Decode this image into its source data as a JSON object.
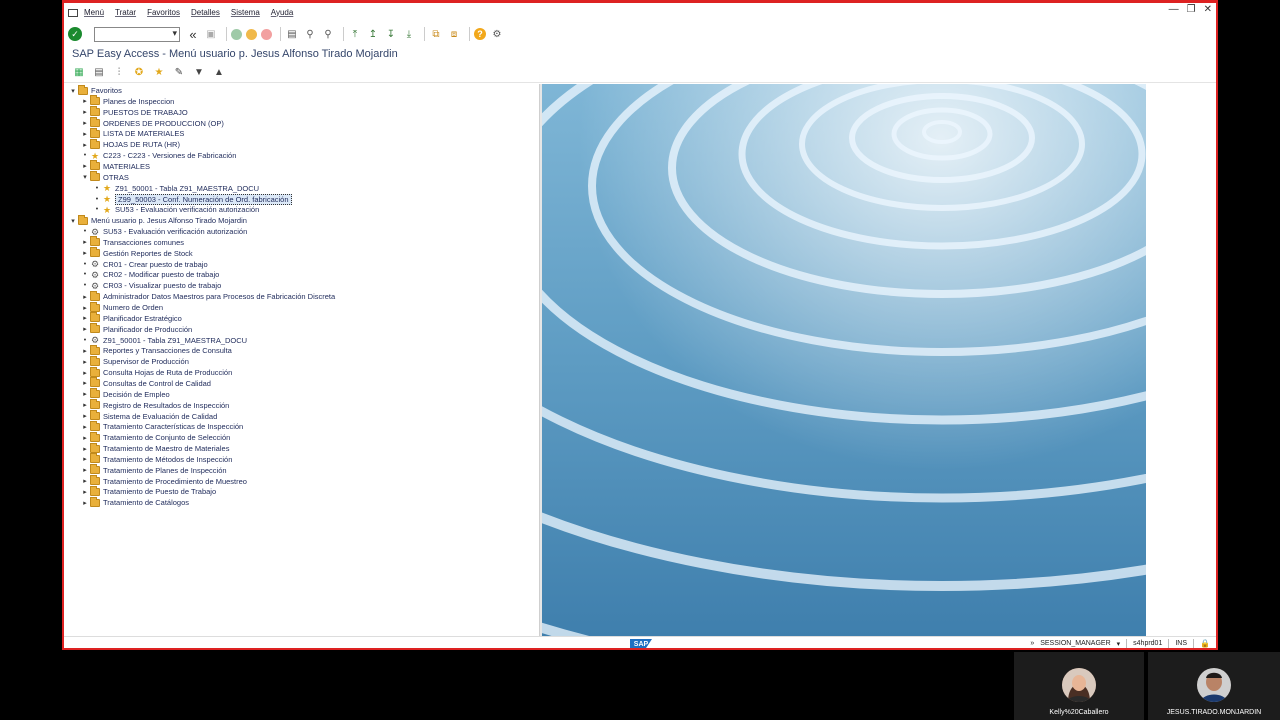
{
  "window": {
    "menu": [
      "Menú",
      "Tratar",
      "Favoritos",
      "Detalles",
      "Sistema",
      "Ayuda"
    ],
    "controls": [
      "—",
      "❐",
      "✕"
    ],
    "title": "SAP Easy Access  -  Menú usuario p. Jesus Alfonso Tirado Mojardin"
  },
  "icons": {
    "ok": "check-icon",
    "back": "double-chevron-left-icon",
    "save": "save-icon",
    "help": "help-icon"
  },
  "tree": [
    {
      "label": "Favoritos",
      "level": 0,
      "expander": "▾",
      "icon": "folder"
    },
    {
      "label": "Planes de Inspeccion",
      "level": 1,
      "expander": "▸",
      "icon": "folder"
    },
    {
      "label": "PUESTOS DE TRABAJO",
      "level": 1,
      "expander": "▸",
      "icon": "folder"
    },
    {
      "label": "ORDENES DE PRODUCCION (OP)",
      "level": 1,
      "expander": "▸",
      "icon": "folder"
    },
    {
      "label": "LISTA DE MATERIALES",
      "level": 1,
      "expander": "▸",
      "icon": "folder"
    },
    {
      "label": "HOJAS DE RUTA (HR)",
      "level": 1,
      "expander": "▸",
      "icon": "folder"
    },
    {
      "label": "C223 - C223 - Versiones de Fabricación",
      "level": 1,
      "expander": "•",
      "icon": "star"
    },
    {
      "label": "MATERIALES",
      "level": 1,
      "expander": "▸",
      "icon": "folder"
    },
    {
      "label": "OTRAS",
      "level": 1,
      "expander": "▾",
      "icon": "folder"
    },
    {
      "label": "Z91_50001 - Tabla Z91_MAESTRA_DOCU",
      "level": 2,
      "expander": "•",
      "icon": "star"
    },
    {
      "label": "Z99_50003 - Conf. Numeración de Ord. fabricación",
      "level": 2,
      "expander": "•",
      "icon": "star",
      "selected": true
    },
    {
      "label": "SU53 - Evaluación verificación autorización",
      "level": 2,
      "expander": "•",
      "icon": "star"
    },
    {
      "label": "Menú usuario p. Jesus Alfonso Tirado Mojardin",
      "level": 0,
      "expander": "▾",
      "icon": "folder"
    },
    {
      "label": "SU53 - Evaluación verificación autorización",
      "level": 1,
      "expander": "•",
      "icon": "gear"
    },
    {
      "label": "Transacciones comunes",
      "level": 1,
      "expander": "▸",
      "icon": "folder"
    },
    {
      "label": "Gestión Reportes de Stock",
      "level": 1,
      "expander": "▸",
      "icon": "folder"
    },
    {
      "label": "CR01 - Crear puesto de trabajo",
      "level": 1,
      "expander": "•",
      "icon": "gear"
    },
    {
      "label": "CR02 - Modificar puesto de trabajo",
      "level": 1,
      "expander": "•",
      "icon": "gear"
    },
    {
      "label": "CR03 - Visualizar puesto de trabajo",
      "level": 1,
      "expander": "•",
      "icon": "gear"
    },
    {
      "label": "Administrador Datos Maestros para Procesos de Fabricación Discreta",
      "level": 1,
      "expander": "▸",
      "icon": "folder"
    },
    {
      "label": "Numero de Orden",
      "level": 1,
      "expander": "▸",
      "icon": "folder"
    },
    {
      "label": "Planificador Estratégico",
      "level": 1,
      "expander": "▸",
      "icon": "folder"
    },
    {
      "label": "Planificador de Producción",
      "level": 1,
      "expander": "▸",
      "icon": "folder"
    },
    {
      "label": "Z91_50001 - Tabla Z91_MAESTRA_DOCU",
      "level": 1,
      "expander": "•",
      "icon": "gear"
    },
    {
      "label": "Reportes y Transacciones de Consulta",
      "level": 1,
      "expander": "▸",
      "icon": "folder"
    },
    {
      "label": "Supervisor de Producción",
      "level": 1,
      "expander": "▸",
      "icon": "folder"
    },
    {
      "label": "Consulta Hojas de Ruta de Producción",
      "level": 1,
      "expander": "▸",
      "icon": "folder"
    },
    {
      "label": "Consultas de Control de Calidad",
      "level": 1,
      "expander": "▸",
      "icon": "folder"
    },
    {
      "label": "Decisión de Empleo",
      "level": 1,
      "expander": "▸",
      "icon": "folder"
    },
    {
      "label": "Registro de Resultados de Inspección",
      "level": 1,
      "expander": "▸",
      "icon": "folder"
    },
    {
      "label": "Sistema de Evaluación de Calidad",
      "level": 1,
      "expander": "▸",
      "icon": "folder"
    },
    {
      "label": "Tratamiento Características de Inspección",
      "level": 1,
      "expander": "▸",
      "icon": "folder"
    },
    {
      "label": "Tratamiento de Conjunto de Selección",
      "level": 1,
      "expander": "▸",
      "icon": "folder"
    },
    {
      "label": "Tratamiento de Maestro de Materiales",
      "level": 1,
      "expander": "▸",
      "icon": "folder"
    },
    {
      "label": "Tratamiento de Métodos de Inspección",
      "level": 1,
      "expander": "▸",
      "icon": "folder"
    },
    {
      "label": "Tratamiento de Planes de Inspección",
      "level": 1,
      "expander": "▸",
      "icon": "folder"
    },
    {
      "label": "Tratamiento de Procedimiento de Muestreo",
      "level": 1,
      "expander": "▸",
      "icon": "folder"
    },
    {
      "label": "Tratamiento de Puesto de Trabajo",
      "level": 1,
      "expander": "▸",
      "icon": "folder"
    },
    {
      "label": "Tratamiento de Catálogos",
      "level": 1,
      "expander": "▸",
      "icon": "folder"
    }
  ],
  "status": {
    "logo": "SAP",
    "arrows": "»",
    "session": "SESSION_MANAGER",
    "dropdown": "▾",
    "server": "s4hprd01",
    "mode": "INS"
  },
  "participants": [
    {
      "name": "Kelly%20Caballero"
    },
    {
      "name": "JESUS.TIRADO.MONJARDIN"
    }
  ],
  "colors": {
    "window_border": "#dd2222",
    "title_text": "#34456a",
    "folder": "#e9b03b"
  }
}
